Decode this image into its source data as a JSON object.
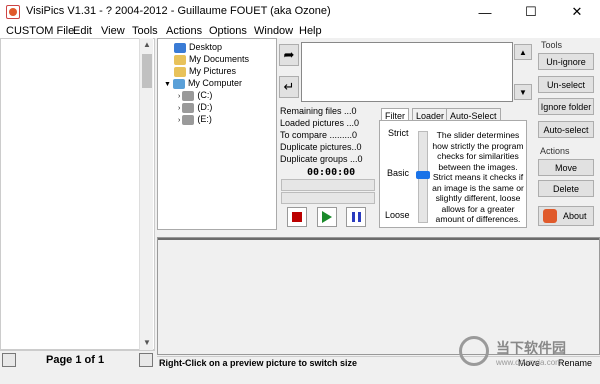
{
  "window": {
    "title": "VisiPics V1.31 - ? 2004-2012 - Guillaume FOUET (aka Ozone)",
    "min_glyph": "—",
    "max_glyph": "☐",
    "close_glyph": "✕"
  },
  "menu": [
    "CUSTOM File",
    "Edit",
    "View",
    "Tools",
    "Actions",
    "Options",
    "Window",
    "Help"
  ],
  "tree": {
    "items": [
      {
        "label": "Desktop",
        "icon": "desktop-icon"
      },
      {
        "label": "My Documents",
        "icon": "folder-icon"
      },
      {
        "label": "My Pictures",
        "icon": "folder-icon"
      },
      {
        "label": "My Computer",
        "icon": "computer-icon"
      },
      {
        "label": "(C:)",
        "icon": "drive-icon"
      },
      {
        "label": "(D:)",
        "icon": "drive-icon"
      },
      {
        "label": "(E:)",
        "icon": "drive-icon"
      }
    ]
  },
  "stats": {
    "remaining": "Remaining files ...0",
    "loaded": "Loaded pictures ...0",
    "compare": "To compare .........0",
    "dup_pictures": "Duplicate pictures..0",
    "dup_groups": "Duplicate groups ...0",
    "timer": "00:00:00"
  },
  "tabs": {
    "filter": "Filter",
    "loader": "Loader",
    "auto_select": "Auto-Select"
  },
  "slider": {
    "strict": "Strict",
    "basic": "Basic",
    "loose": "Loose",
    "level": 0.45
  },
  "help_text": "The slider determines how strictly the program checks for similarities between the images. Strict means it checks if an image is the same or slightly different, loose allows for a greater amount of differences.",
  "tools": {
    "heading": "Tools",
    "unignore": "Un-ignore",
    "unselect": "Un-select",
    "ignore_folder": "Ignore folder",
    "auto_select": "Auto-select"
  },
  "actions": {
    "heading": "Actions",
    "move": "Move",
    "delete": "Delete",
    "about": "About"
  },
  "page": {
    "label": "Page 1 of 1"
  },
  "status": {
    "text": "Right-Click on a preview picture to switch size",
    "move": "Move",
    "rename": "Rename"
  },
  "watermark": {
    "title": "当下软件园",
    "url": "www.downxia.com"
  }
}
